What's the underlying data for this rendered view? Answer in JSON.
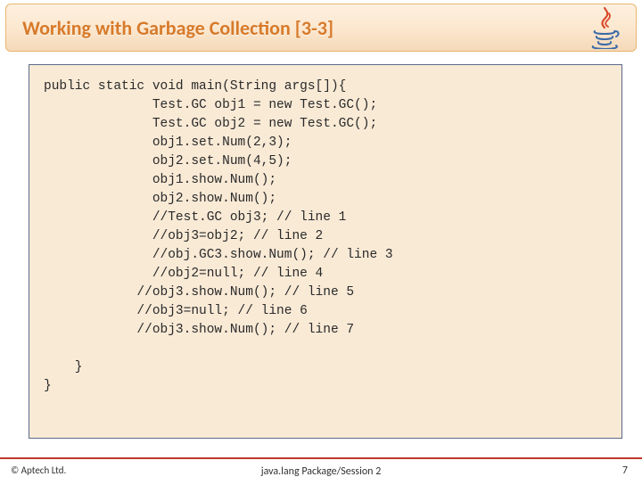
{
  "header": {
    "title": "Working with Garbage Collection [3-3]"
  },
  "code": {
    "lines": [
      "public static void main(String args[]){",
      "              Test.GC obj1 = new Test.GC();",
      "              Test.GC obj2 = new Test.GC();",
      "              obj1.set.Num(2,3);",
      "              obj2.set.Num(4,5);",
      "              obj1.show.Num();",
      "              obj2.show.Num();",
      "              //Test.GC obj3; // line 1",
      "              //obj3=obj2; // line 2",
      "              //obj.GC3.show.Num(); // line 3",
      "              //obj2=null; // line 4",
      "            //obj3.show.Num(); // line 5",
      "            //obj3=null; // line 6",
      "            //obj3.show.Num(); // line 7",
      "",
      "    }",
      "}"
    ]
  },
  "footer": {
    "copyright": "© Aptech Ltd.",
    "center": "java.lang Package/Session 2",
    "page": "7"
  }
}
